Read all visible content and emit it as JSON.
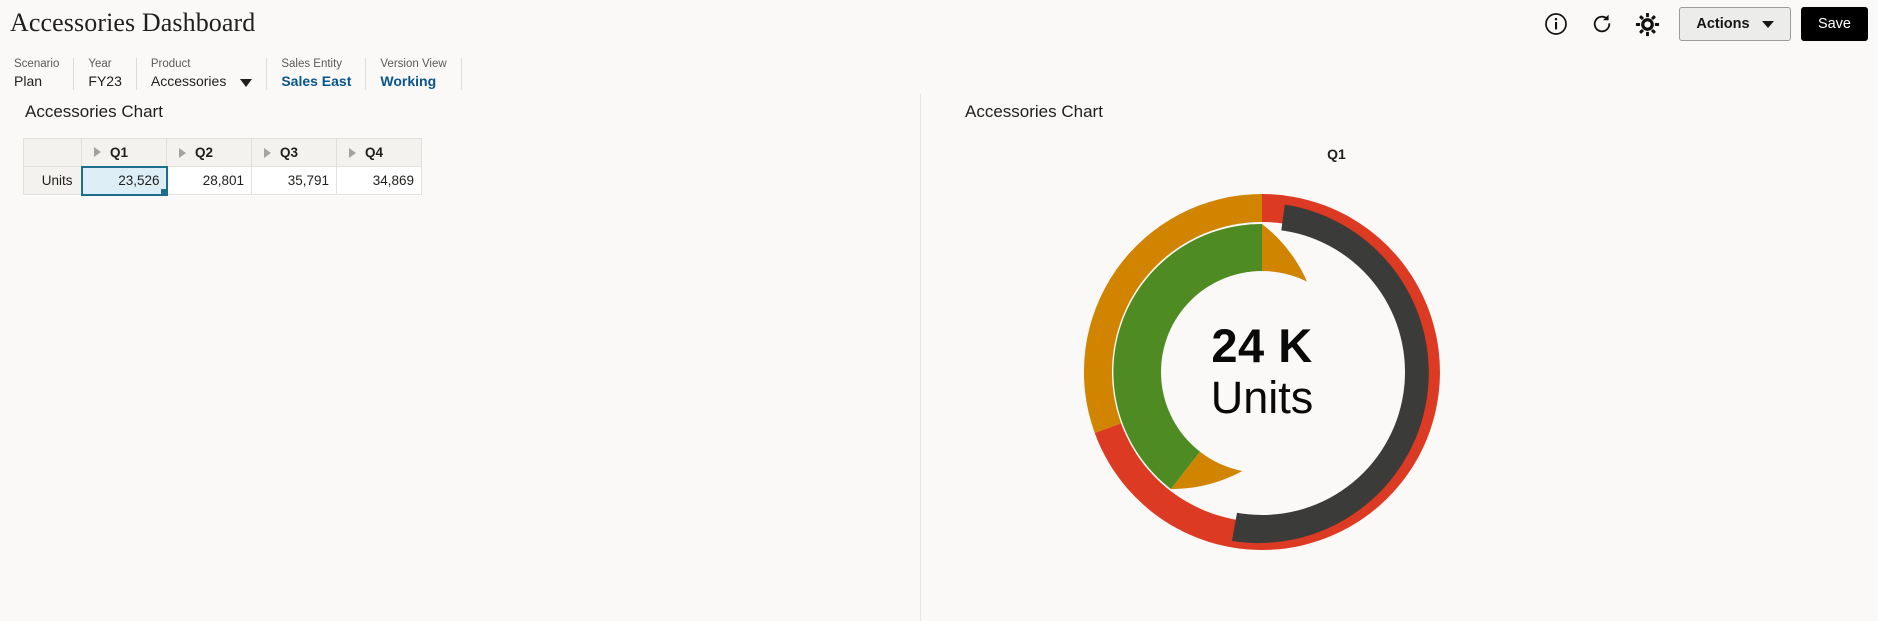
{
  "header": {
    "title": "Accessories Dashboard",
    "icons": [
      {
        "name": "info-icon",
        "glyph": "info"
      },
      {
        "name": "refresh-icon",
        "glyph": "refresh"
      },
      {
        "name": "gear-icon",
        "glyph": "gear"
      }
    ],
    "actions_label": "Actions",
    "save_label": "Save"
  },
  "pov": [
    {
      "label": "Scenario",
      "value": "Plan",
      "link": false,
      "dropdown": false
    },
    {
      "label": "Year",
      "value": "FY23",
      "link": false,
      "dropdown": false
    },
    {
      "label": "Product",
      "value": "Accessories",
      "link": false,
      "dropdown": true
    },
    {
      "label": "Sales Entity",
      "value": "Sales East",
      "link": true,
      "dropdown": false
    },
    {
      "label": "Version View",
      "value": "Working",
      "link": true,
      "dropdown": false
    }
  ],
  "left_panel": {
    "title": "Accessories Chart",
    "grid": {
      "corner_label": "",
      "columns": [
        "Q1",
        "Q2",
        "Q3",
        "Q4"
      ],
      "rows": [
        {
          "label": "Units",
          "values": [
            "23,526",
            "28,801",
            "35,791",
            "34,869"
          ]
        }
      ],
      "selected_cell": {
        "row": 0,
        "col": 0
      }
    }
  },
  "right_panel": {
    "title": "Accessories Chart",
    "chart_label": "Q1",
    "center_value": "24 K",
    "center_unit": "Units"
  },
  "chart_data": {
    "type": "pie",
    "title": "Accessories Chart",
    "subtitle": "Q1",
    "center_label": "24 K Units",
    "legend": "none",
    "rings": [
      {
        "name": "outer-ring",
        "inner_radius_pct": 72,
        "outer_radius_pct": 100,
        "slices": [
          {
            "label": "segment-red",
            "color": "#dc3a22",
            "start_deg": 0,
            "end_deg": 250,
            "value": 69.4
          },
          {
            "label": "segment-orange",
            "color": "#d08400",
            "start_deg": 250,
            "end_deg": 360,
            "value": 30.6
          }
        ]
      },
      {
        "name": "middle-ring",
        "inner_radius_pct": 76,
        "outer_radius_pct": 93,
        "slices": [
          {
            "label": "segment-dark",
            "color": "#3b3b39",
            "start_deg": 8,
            "end_deg": 262,
            "value": 70.6
          }
        ]
      },
      {
        "name": "inner-donut",
        "inner_radius_pct": 58,
        "outer_radius_pct": 86,
        "slices": [
          {
            "label": "segment-green",
            "color": "#4e8b23",
            "start_deg": 0,
            "end_deg": -142,
            "value": 39.4
          },
          {
            "label": "segment-orange",
            "color": "#d08400",
            "start_deg": -142,
            "end_deg": -360,
            "value": 60.6
          }
        ]
      }
    ],
    "colors": {
      "red": "#dc3a22",
      "orange": "#d08400",
      "green": "#4e8b23",
      "dark": "#3b3b39",
      "background": "#faf9f7"
    }
  },
  "theme": {
    "background": "#faf9f7",
    "accent_link": "#0a558c",
    "selection": "#1c6e8c",
    "save_button_bg": "#000000"
  }
}
